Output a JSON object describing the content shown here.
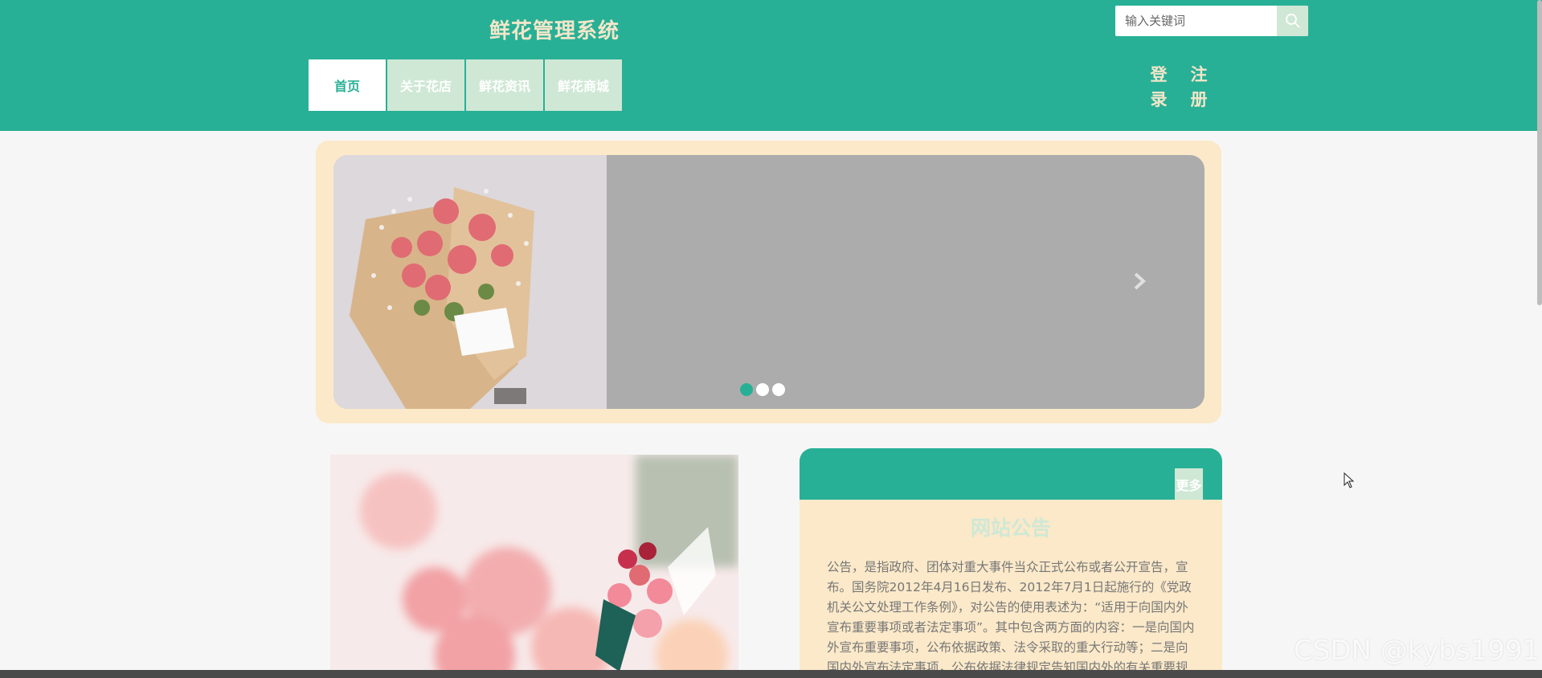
{
  "header": {
    "site_title": "鲜花管理系统",
    "search_placeholder": "输入关键词",
    "nav": [
      {
        "label": "首页",
        "active": true
      },
      {
        "label": "关于花店"
      },
      {
        "label": "鲜花资讯"
      },
      {
        "label": "鲜花商城"
      }
    ],
    "auth": {
      "login": "登录",
      "register": "注册"
    }
  },
  "carousel": {
    "dots": 3,
    "active_dot": 1
  },
  "notice": {
    "more_label": "更多",
    "title": "网站公告",
    "body": "公告，是指政府、团体对重大事件当众正式公布或者公开宣告，宣布。国务院2012年4月16日发布、2012年7月1日起施行的《党政机关公文处理工作条例》，对公告的使用表述为：“适用于向国内外宣布重要事项或者法定事项”。其中包含两方面的内容：一是向国内外宣布重要事项，公布依据政策、法令采取的重大行动等；二是向国内外宣布法定事项，公布依据法律规定告知国内外的有关重要规定和重大行动等。"
  },
  "watermark": "CSDN @kybs1991",
  "colors": {
    "primary": "#28b096",
    "accent_light": "#cfe8d5",
    "cream": "#fbe9c9"
  }
}
